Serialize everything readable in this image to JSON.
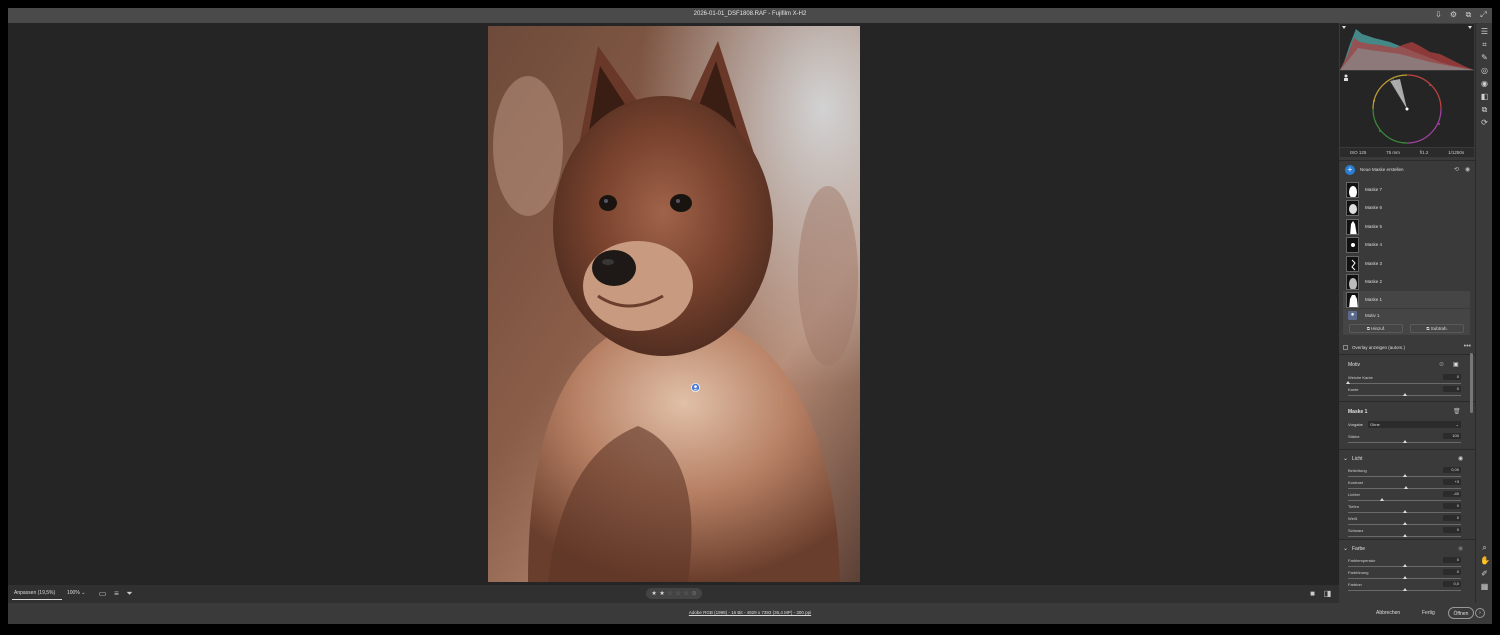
{
  "window": {
    "title": "2026-01-01_DSF1808.RAF  -  Fujifilm X-H2"
  },
  "exif": {
    "iso": "ISO 125",
    "focal": "75 mm",
    "aperture": "f/1.2",
    "shutter": "1/1250s"
  },
  "masks": {
    "new_label": "Neue Maske erstellen",
    "items": [
      "Maske 7",
      "Maske 6",
      "Maske 5",
      "Maske 4",
      "Maske 3",
      "Maske 2",
      "Maske 1"
    ],
    "sub_item": "Motiv 1",
    "add_label": "Hinzuf.",
    "subtract_label": "Subtrah.",
    "overlay_label": "Overlay anzeigen (autom.)"
  },
  "motiv": {
    "title": "Motiv",
    "sliders": [
      {
        "label": "Weiche Kante",
        "value": "0",
        "pos": 0
      },
      {
        "label": "Kante",
        "value": "0",
        "pos": 0.5
      }
    ]
  },
  "mask1": {
    "title": "Maske 1",
    "preset_label": "Vorgabe",
    "preset_value": "Ohne",
    "strength_label": "Stärke",
    "strength_value": "100",
    "strength_pos": 0.5
  },
  "licht": {
    "title": "Licht",
    "sliders": [
      {
        "label": "Belichtung",
        "value": "0,00",
        "pos": 0.5
      },
      {
        "label": "Kontrast",
        "value": "+3",
        "pos": 0.51
      },
      {
        "label": "Lichter",
        "value": "-40",
        "pos": 0.3
      },
      {
        "label": "Tiefen",
        "value": "0",
        "pos": 0.5
      },
      {
        "label": "Weiß",
        "value": "0",
        "pos": 0.5
      },
      {
        "label": "Schwarz",
        "value": "0",
        "pos": 0.5
      }
    ]
  },
  "farbe": {
    "title": "Farbe",
    "sliders": [
      {
        "label": "Farbtemperatur",
        "value": "0",
        "pos": 0.5
      },
      {
        "label": "Farbtönung",
        "value": "0",
        "pos": 0.5
      },
      {
        "label": "Farbton",
        "value": "0,0",
        "pos": 0.5
      }
    ]
  },
  "bottombar": {
    "zoom_fit": "Anpassen (19,5%)",
    "zoom_100": "100%",
    "rating": 2,
    "rating_max": 5
  },
  "footer": {
    "file_info": "Adobe RGB (1998) - 16 Bit - 4929 x 7393 (36,4 MP) - 300 ppi",
    "cancel": "Abbrechen",
    "done": "Fertig",
    "open": "Öffnen",
    "open_arrow": "›"
  },
  "colors": {
    "accent": "#2a7fd4",
    "panel": "#3a3a3a",
    "canvas": "#252525"
  }
}
